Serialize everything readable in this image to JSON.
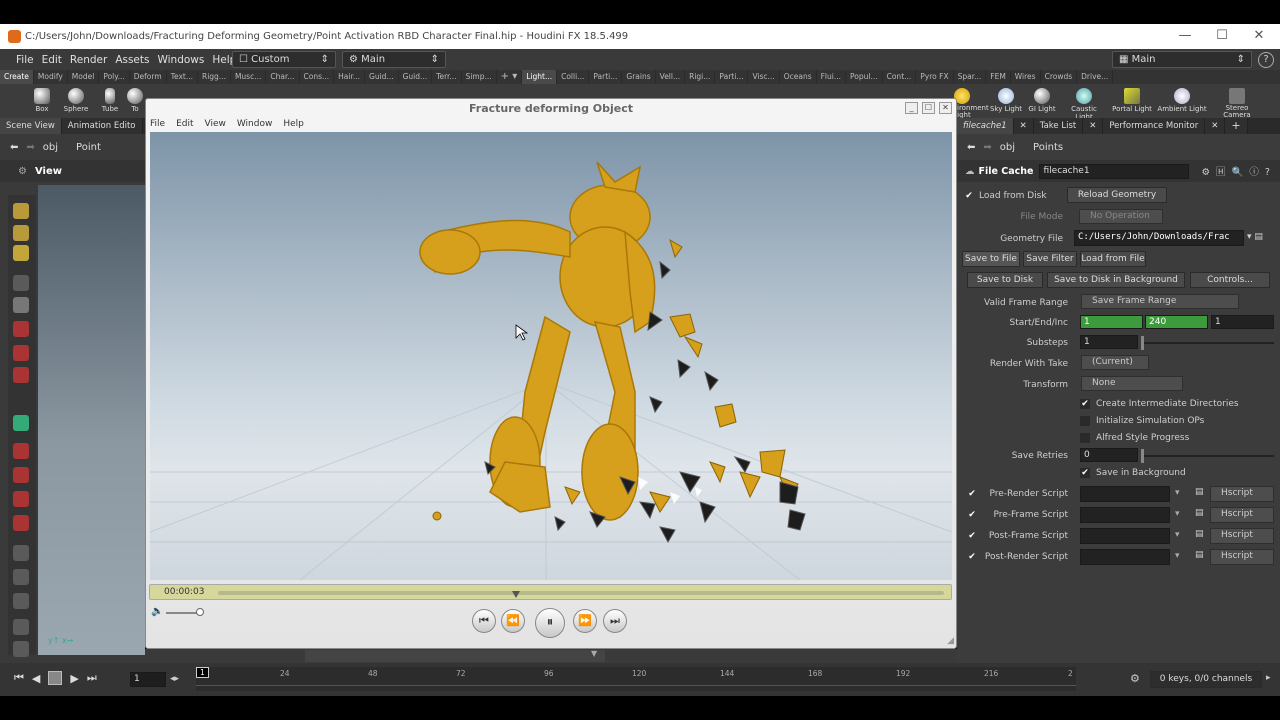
{
  "window": {
    "title": "C:/Users/John/Downloads/Fracturing Deforming Geometry/Point Activation RBD Character Final.hip - Houdini FX 18.5.499",
    "controls": [
      "—",
      "☐",
      "✕"
    ]
  },
  "menubar": {
    "items": [
      "File",
      "Edit",
      "Render",
      "Assets",
      "Windows",
      "Help"
    ],
    "desktop": "Custom",
    "main_left": "Main",
    "main_right": "Main"
  },
  "shelf": {
    "tabs_left": [
      "Create",
      "Modify",
      "Model",
      "Poly...",
      "Deform",
      "Text...",
      "Rigg...",
      "Musc...",
      "Char...",
      "Cons...",
      "Hair...",
      "Guid...",
      "Guid...",
      "Terr...",
      "Simp..."
    ],
    "tabs_right": [
      "Light...",
      "Colli...",
      "Parti...",
      "Grains",
      "Vell...",
      "Rigi...",
      "Parti...",
      "Visc...",
      "Oceans",
      "Flui...",
      "Popul...",
      "Cont...",
      "Pyro FX",
      "Spar...",
      "FEM",
      "Wires",
      "Crowds",
      "Drive..."
    ],
    "tools_left": [
      "Box",
      "Sphere",
      "Tube",
      "To"
    ],
    "tools_right": [
      "Environment Light",
      "Sky Light",
      "GI Light",
      "Caustic Light",
      "Portal Light",
      "Ambient Light",
      "Stereo Camera"
    ]
  },
  "left_panel": {
    "tabs": [
      "Scene View",
      "Animation Edito"
    ],
    "path_obj": "obj",
    "path_node": "Point",
    "view_label": "View"
  },
  "player": {
    "title": "Fracture deforming Object",
    "menu": [
      "File",
      "Edit",
      "View",
      "Window",
      "Help"
    ],
    "timecode": "00:00:03",
    "progress": 0.41,
    "buttons": [
      "⏮",
      "⏪",
      "⏸",
      "⏩",
      "⏭"
    ]
  },
  "right_panel": {
    "tabs": [
      "filecache1",
      "Take List",
      "Performance Monitor"
    ],
    "path_obj": "obj",
    "path_node": "Points",
    "node_type": "File Cache",
    "node_name": "filecache1",
    "load_from_disk": "Load from Disk",
    "reload_geometry": "Reload Geometry",
    "file_mode_label": "File Mode",
    "file_mode_value": "No Operation",
    "geometry_file_label": "Geometry File",
    "geometry_file_value": "C:/Users/John/Downloads/Frac",
    "subtabs": [
      "Save to File",
      "Save Filter",
      "Load from File"
    ],
    "save_to_disk": "Save to Disk",
    "save_bg": "Save to Disk in Background",
    "controls": "Controls...",
    "valid_frame_range_label": "Valid Frame Range",
    "valid_frame_range_value": "Save Frame Range",
    "start_end_inc_label": "Start/End/Inc",
    "start": "1",
    "end": "240",
    "inc": "1",
    "substeps_label": "Substeps",
    "substeps": "1",
    "render_with_take_label": "Render With Take",
    "render_with_take_value": "(Current)",
    "transform_label": "Transform",
    "transform_value": "None",
    "create_dirs": "Create Intermediate Directories",
    "init_sim": "Initialize Simulation OPs",
    "alfred": "Alfred Style Progress",
    "save_retries_label": "Save Retries",
    "save_retries": "0",
    "save_in_bg": "Save in Background",
    "scripts": [
      {
        "label": "Pre-Render Script",
        "lang": "Hscript"
      },
      {
        "label": "Pre-Frame Script",
        "lang": "Hscript"
      },
      {
        "label": "Post-Frame Script",
        "lang": "Hscript"
      },
      {
        "label": "Post-Render Script",
        "lang": "Hscript"
      }
    ]
  },
  "timeline": {
    "frame": "1",
    "current": "1",
    "ticks": [
      "24",
      "48",
      "72",
      "96",
      "120",
      "144",
      "168",
      "192",
      "216",
      "2"
    ],
    "keys": "0 keys, 0/0 channels"
  }
}
